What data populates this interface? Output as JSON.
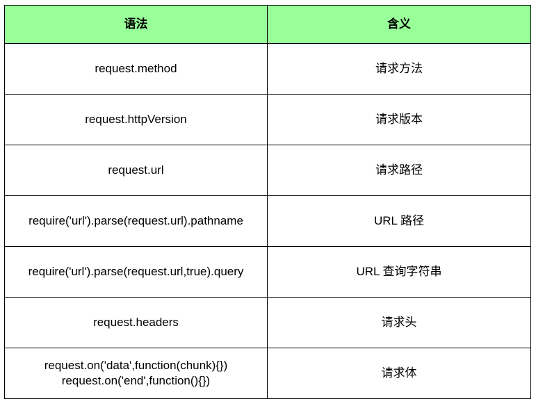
{
  "table": {
    "headers": [
      "语法",
      "含义"
    ],
    "rows": [
      {
        "syntax": [
          "request.method"
        ],
        "meaning": "请求方法"
      },
      {
        "syntax": [
          "request.httpVersion"
        ],
        "meaning": "请求版本"
      },
      {
        "syntax": [
          "request.url"
        ],
        "meaning": "请求路径"
      },
      {
        "syntax": [
          "require('url').parse(request.url).pathname"
        ],
        "meaning": "URL 路径"
      },
      {
        "syntax": [
          "require('url').parse(request.url,true).query"
        ],
        "meaning": "URL 查询字符串"
      },
      {
        "syntax": [
          "request.headers"
        ],
        "meaning": "请求头"
      },
      {
        "syntax": [
          "request.on('data',function(chunk){})",
          "request.on('end',function(){})"
        ],
        "meaning": "请求体"
      }
    ]
  },
  "colors": {
    "header_bg": "#99ff99",
    "border": "#000000"
  }
}
